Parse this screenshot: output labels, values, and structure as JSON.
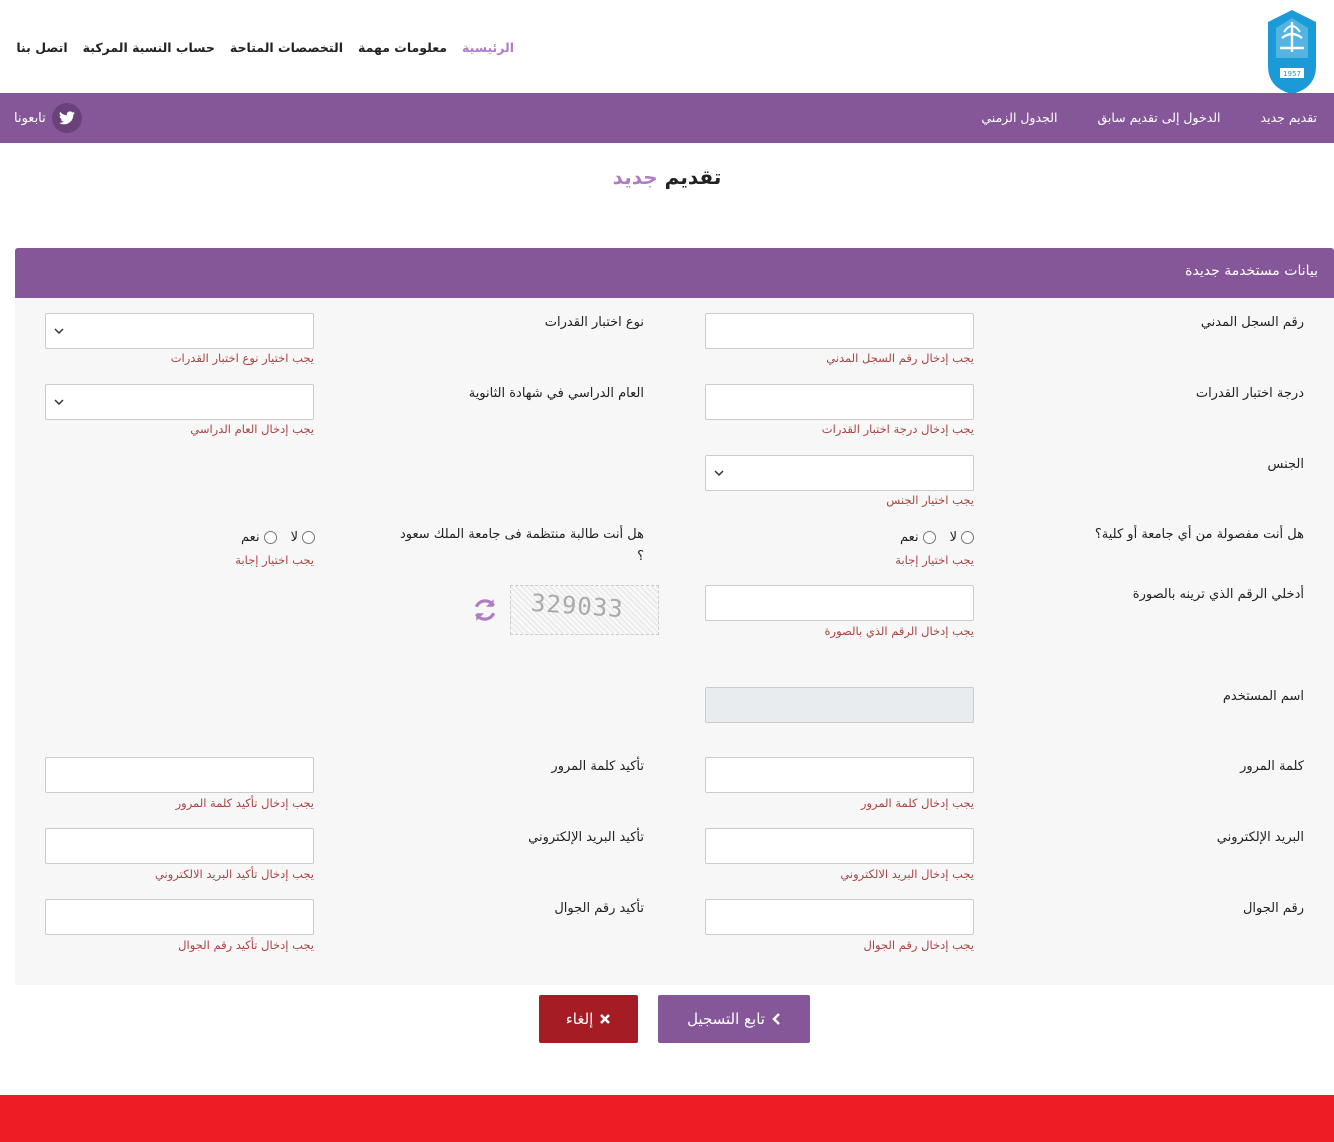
{
  "header": {
    "nav": [
      {
        "label": "الرئيسية",
        "active": true
      },
      {
        "label": "معلومات مهمة",
        "active": false
      },
      {
        "label": "التخصصات المتاحة",
        "active": false
      },
      {
        "label": "حساب النسبة المركبة",
        "active": false
      },
      {
        "label": "اتصل بنا",
        "active": false
      }
    ],
    "logo_year": "1957"
  },
  "subnav": {
    "links": [
      "تقديم جديد",
      "الدخول إلى تقديم سابق",
      "الجدول الزمني"
    ],
    "follow_label": "تابعونا",
    "follow_icon": "twitter-icon"
  },
  "page_title": {
    "part1": "تقديم",
    "part2": "جديد"
  },
  "form": {
    "panel_title": "بيانات مستخدمة جديدة",
    "national_id": {
      "label": "رقم السجل المدني",
      "error": "يجب إدخال رقم السجل المدني"
    },
    "test_type": {
      "label": "نوع اختبار القدرات",
      "error": "يجب اختيار نوع اختبار القدرات"
    },
    "test_score": {
      "label": "درجة اختبار القدرات",
      "error": "يجب إدخال درجة اختبار القدرات"
    },
    "school_year": {
      "label": "العام الدراسي في شهادة الثانوية",
      "error": "يجب إدخال العام الدراسي"
    },
    "gender": {
      "label": "الجنس",
      "error": "يجب اختيار الجنس"
    },
    "dismissed": {
      "label": "هل أنت مفصولة من أي جامعة أو كلية؟",
      "no": "لا",
      "yes": "نعم",
      "error": "يجب اختيار إجابة"
    },
    "regular_student": {
      "label": "هل أنت طالبة منتظمة فى جامعة الملك سعود ؟",
      "no": "لا",
      "yes": "نعم",
      "error": "يجب اختيار إجابة"
    },
    "captcha": {
      "label": "أدخلي الرقم الذي ترينه بالصورة",
      "error": "يجب إدخال الرقم الذي بالصورة",
      "image_text": "329033"
    },
    "username": {
      "label": "اسم المستخدم"
    },
    "password": {
      "label": "كلمة المرور",
      "error": "يجب إدخال كلمة المرور"
    },
    "password_confirm": {
      "label": "تأكيد كلمة المرور",
      "error": "يجب إدخال تأكيد كلمة المرور"
    },
    "email": {
      "label": "البريد الإلكتروني",
      "error": "يجب إدخال البريد الالكتروني"
    },
    "email_confirm": {
      "label": "تأكيد البريد الإلكتروني",
      "error": "يجب إدخال تأكيد البريد الالكتروني"
    },
    "mobile": {
      "label": "رقم الجوال",
      "error": "يجب إدخال رقم الجوال"
    },
    "mobile_confirm": {
      "label": "تأكيد رقم الجوال",
      "error": "يجب إدخال تأكيد رقم الجوال"
    }
  },
  "buttons": {
    "next": "تابع التسجيل",
    "cancel": "إلغاء"
  },
  "colors": {
    "primary": "#865798",
    "accent": "#b07cc6",
    "danger": "#a61c24",
    "error_text": "#a94442",
    "footer": "#ee1c25"
  }
}
